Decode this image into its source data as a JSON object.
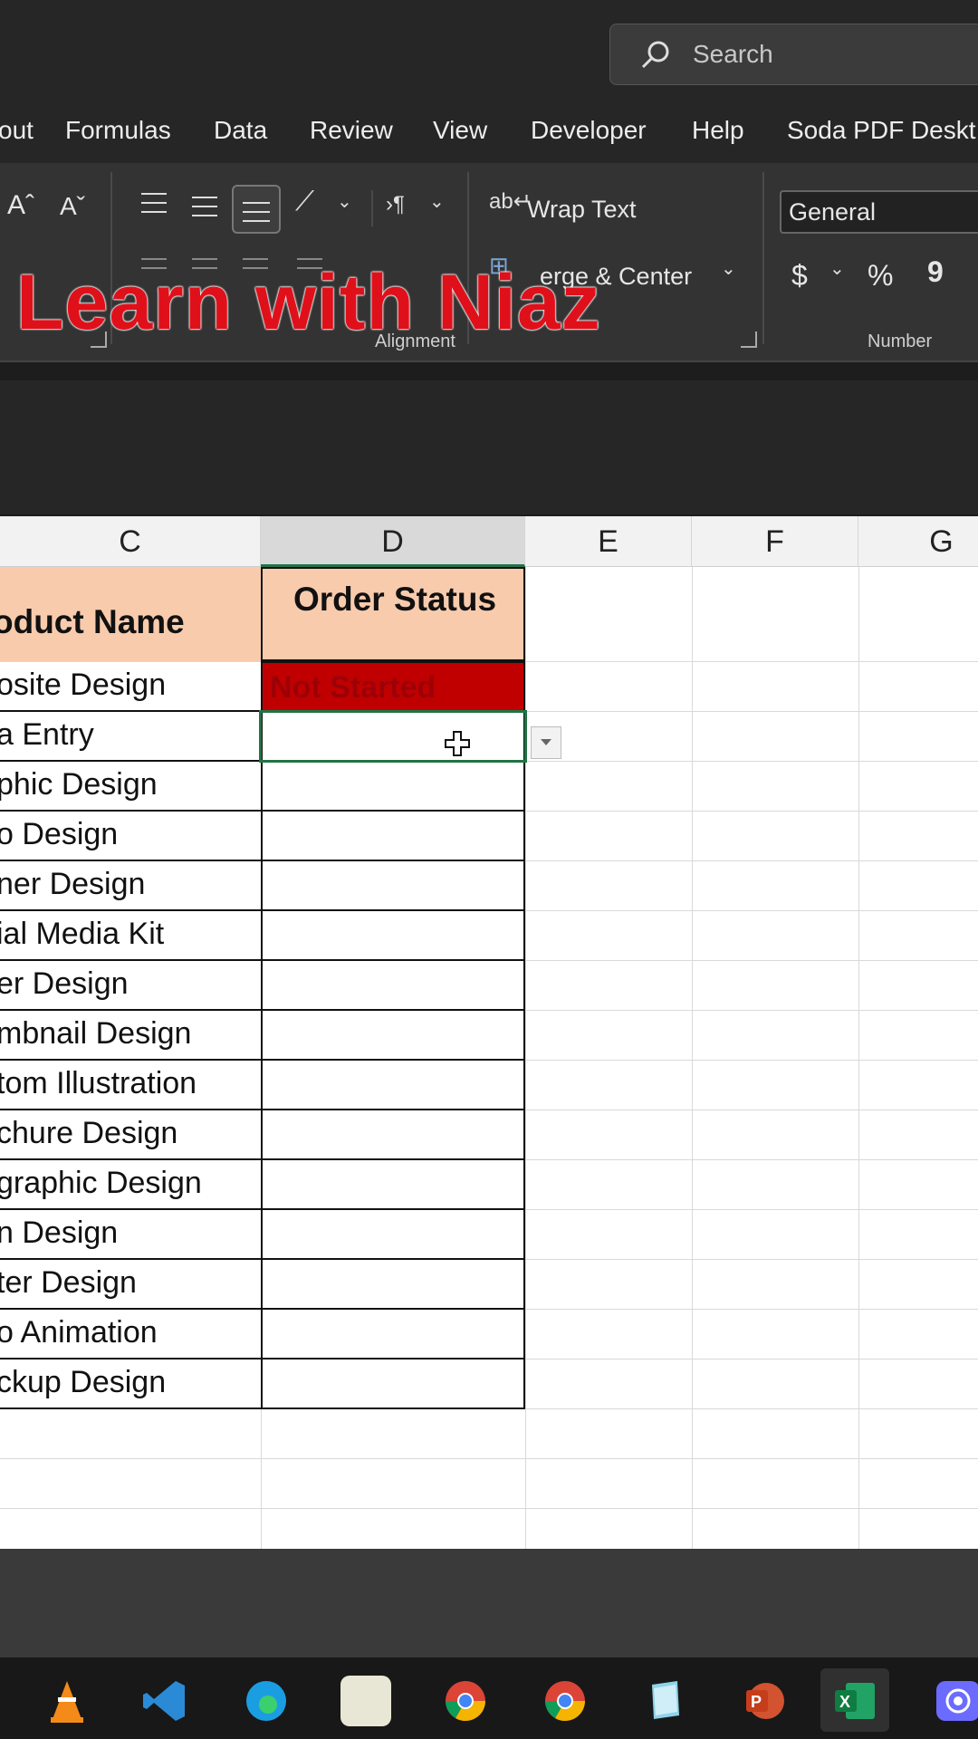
{
  "search": {
    "placeholder": "Search"
  },
  "tabs": [
    "out",
    "Formulas",
    "Data",
    "Review",
    "View",
    "Developer",
    "Help",
    "Soda PDF Deskt"
  ],
  "ribbon": {
    "wrap_text": "Wrap Text",
    "merge_center": "erge & Center",
    "number_format": "General",
    "alignment_label": "Alignment",
    "number_label": "Number",
    "currency": "$",
    "percent": "%",
    "comma": "9",
    "font_up": "Aˆ",
    "font_down": "Aˇ"
  },
  "watermark": "Learn with Niaz",
  "columns": [
    "C",
    "D",
    "E",
    "F",
    "G"
  ],
  "headers": {
    "product_name": "oduct Name",
    "order_status": "Order Status"
  },
  "rows": [
    {
      "product": "osite Design",
      "status": "Not Started"
    },
    {
      "product": "a Entry",
      "status": ""
    },
    {
      "product": "phic Design",
      "status": ""
    },
    {
      "product": "o Design",
      "status": ""
    },
    {
      "product": "ner Design",
      "status": ""
    },
    {
      "product": "ial Media Kit",
      "status": ""
    },
    {
      "product": "er Design",
      "status": ""
    },
    {
      "product": "mbnail Design",
      "status": ""
    },
    {
      "product": "tom Illustration",
      "status": ""
    },
    {
      "product": "chure Design",
      "status": ""
    },
    {
      "product": "graphic Design",
      "status": ""
    },
    {
      "product": "n Design",
      "status": ""
    },
    {
      "product": "ter Design",
      "status": ""
    },
    {
      "product": "o Animation",
      "status": ""
    },
    {
      "product": "ckup Design",
      "status": ""
    }
  ],
  "colors": {
    "header_fill": "#f8cbad",
    "not_started_fill": "#c00000",
    "accent": "#217346",
    "watermark": "#e0101a"
  },
  "taskbar_icons": [
    "vlc-icon",
    "vscode-icon",
    "edge-icon",
    "blank-app-icon",
    "chrome-icon",
    "chrome-profile-icon",
    "notepad-icon",
    "powerpoint-icon",
    "excel-icon",
    "screen-recorder-icon"
  ]
}
